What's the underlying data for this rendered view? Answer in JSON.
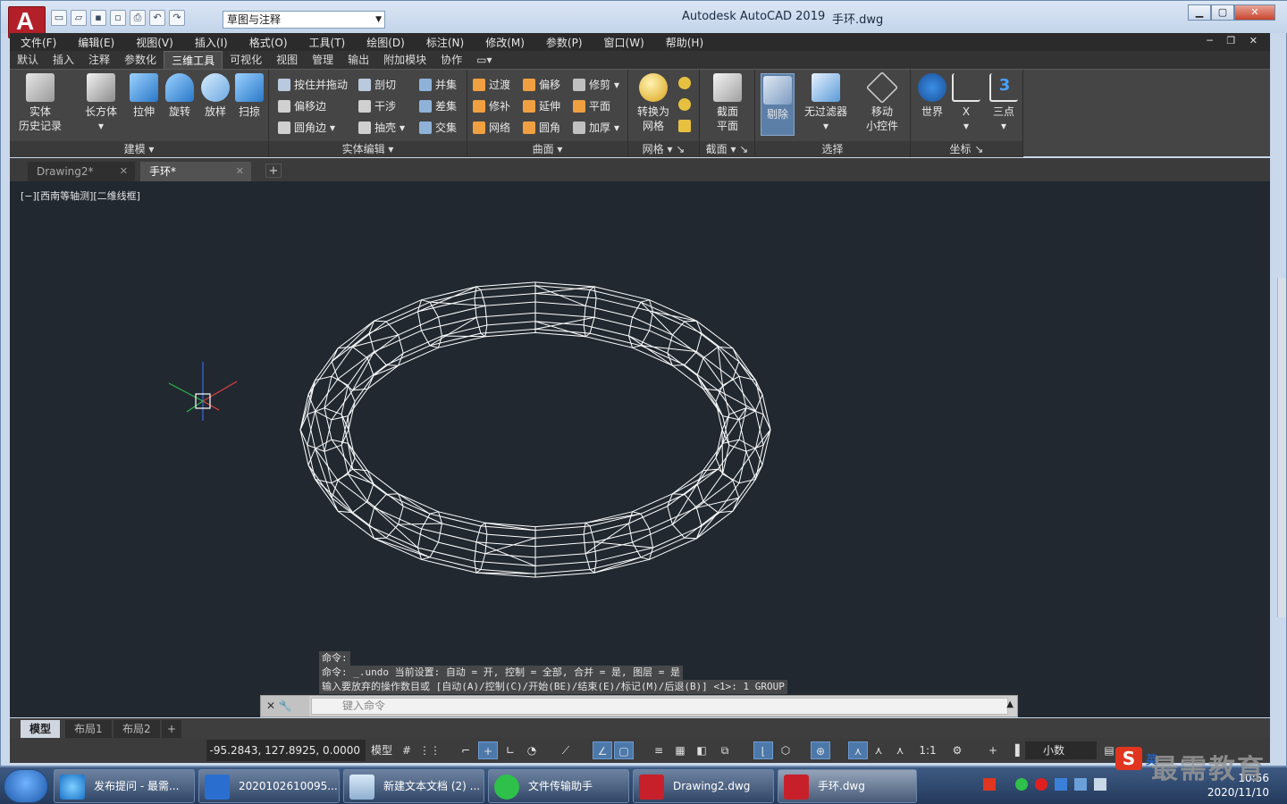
{
  "window": {
    "app_title": "Autodesk AutoCAD 2019",
    "file_title": "手环.dwg",
    "workspace": "草图与注释"
  },
  "menu": [
    "文件(F)",
    "编辑(E)",
    "视图(V)",
    "插入(I)",
    "格式(O)",
    "工具(T)",
    "绘图(D)",
    "标注(N)",
    "修改(M)",
    "参数(P)",
    "窗口(W)",
    "帮助(H)"
  ],
  "ribbon_tabs": [
    "默认",
    "插入",
    "注释",
    "参数化",
    "三维工具",
    "可视化",
    "视图",
    "管理",
    "输出",
    "附加模块",
    "协作"
  ],
  "ribbon": {
    "modeling_title": "建模",
    "solid_history_1": "实体",
    "solid_history_2": "历史记录",
    "box": "长方体",
    "extrude": "拉伸",
    "revolve": "旋转",
    "loft": "放样",
    "sweep": "扫掠",
    "solid_edit_title": "实体编辑",
    "presspull": "按住并拖动",
    "slice": "剖切",
    "union": "并集",
    "offset_edge": "偏移边",
    "interfere": "干涉",
    "subtract": "差集",
    "fillet_edge": "圆角边",
    "shell": "抽壳",
    "intersect": "交集",
    "surface_title": "曲面",
    "blend": "过渡",
    "offset": "偏移",
    "trim": "修剪",
    "patch": "修补",
    "extend": "延伸",
    "planar": "平面",
    "network": "网络",
    "fillet": "圆角",
    "thicken": "加厚",
    "mesh_title": "网格",
    "convert_mesh_1": "转换为",
    "convert_mesh_2": "网格",
    "section_title": "截面",
    "section_plane_1": "截面",
    "section_plane_2": "平面",
    "selection_title": "选择",
    "cull": "剔除",
    "no_filter": "无过滤器",
    "move_gizmo_1": "移动",
    "move_gizmo_2": "小控件",
    "coords_title": "坐标",
    "world": "世界",
    "x_axis": "X",
    "three_point": "三点"
  },
  "doc_tabs": [
    "Drawing2*",
    "手环*"
  ],
  "viewport_label": "[−][西南等轴测][二维线框]",
  "command_history": [
    "命令:",
    "命令: _.undo 当前设置: 自动 = 开, 控制 = 全部, 合并 = 是, 图层 = 是",
    "输入要放弃的操作数目或 [自动(A)/控制(C)/开始(BE)/结束(E)/标记(M)/后退(B)] <1>: 1 GROUP"
  ],
  "command_placeholder": "键入命令",
  "layout_tabs": [
    "模型",
    "布局1",
    "布局2"
  ],
  "status": {
    "coordinates": "-95.2843, 127.8925, 0.0000",
    "model": "模型",
    "scale": "1:1",
    "units": "小数"
  },
  "taskbar": {
    "items": [
      "发布提问 - 最需...",
      "2020102610095...",
      "新建文本文档 (2) ...",
      "文件传输助手",
      "Drawing2.dwg",
      "手环.dwg"
    ],
    "time": "10:56",
    "date": "2020/11/10"
  },
  "watermark": "最需教育",
  "watermark_lang": "英",
  "colors": {
    "canvas_bg": "#212830",
    "wireframe": "#ffffff",
    "selected_tool": "#5c7fa8"
  }
}
